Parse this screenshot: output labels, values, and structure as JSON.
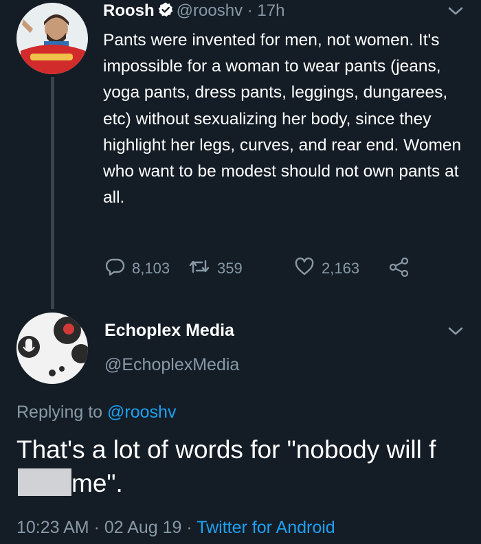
{
  "tweet1": {
    "name": "Roosh",
    "handle": "@rooshv",
    "separator": "·",
    "time": "17h",
    "text": "Pants were invented for men, not women. It's impossible for a woman to wear pants (jeans, yoga pants, dress pants, leggings, dungarees, etc) without sexualizing her body, since they highlight her legs, curves, and rear end. Women who want to be modest should not own pants at all.",
    "replies": "8,103",
    "retweets": "359",
    "likes": "2,163",
    "menu_icon": "chevron-down-icon"
  },
  "tweet2": {
    "name": "Echoplex Media",
    "handle": "@EchoplexMedia",
    "replying_prefix": "Replying to ",
    "replying_to": "@rooshv",
    "text_before": "That's a lot of words for \"nobody will f",
    "text_after": "me\".",
    "timestamp": "10:23 AM · 02 Aug 19 · ",
    "client": "Twitter for Android",
    "menu_icon": "chevron-down-icon"
  },
  "colors": {
    "background": "#141d26",
    "text": "#ffffff",
    "secondary": "#8899a6",
    "link": "#1da1f2",
    "verified": "#ffffff"
  }
}
